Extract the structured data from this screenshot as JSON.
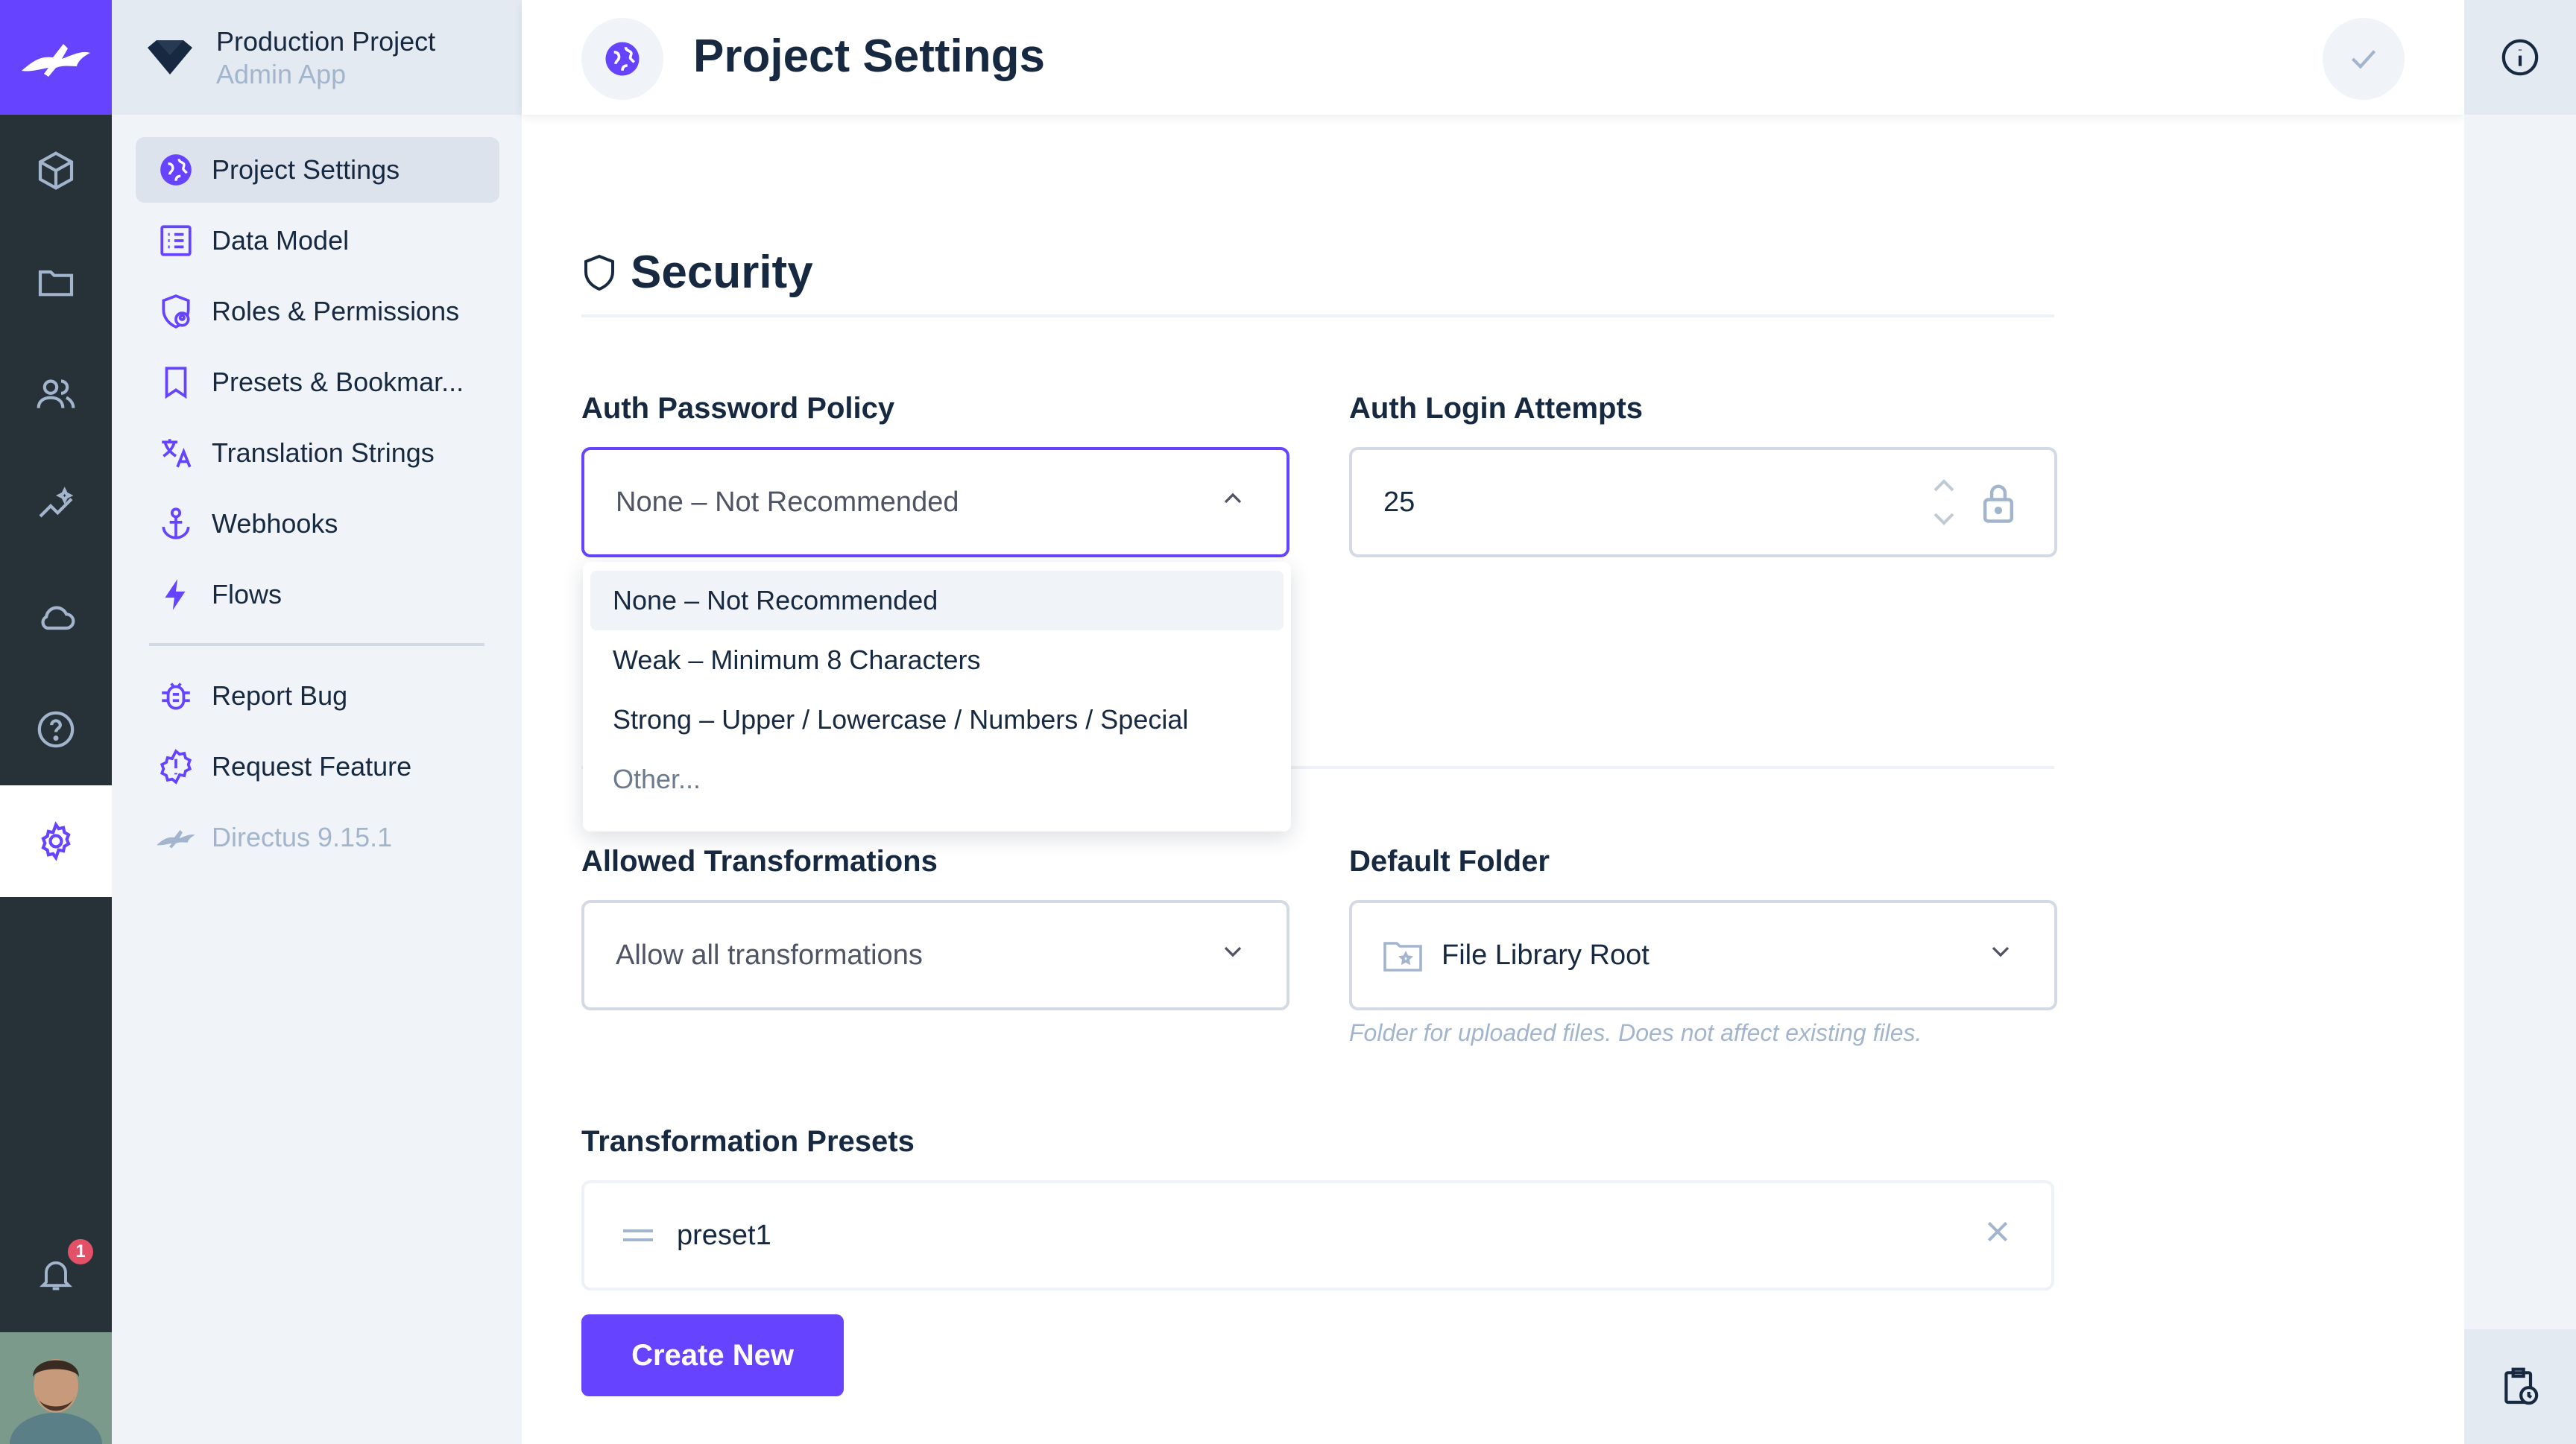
{
  "project": {
    "name": "Production Project",
    "subtitle": "Admin App"
  },
  "header": {
    "title": "Project Settings"
  },
  "nav": {
    "items": [
      {
        "label": "Project Settings",
        "icon": "globe-icon",
        "active": true
      },
      {
        "label": "Data Model",
        "icon": "list-alt-icon"
      },
      {
        "label": "Roles & Permissions",
        "icon": "shield-user-icon"
      },
      {
        "label": "Presets & Bookmar...",
        "icon": "bookmark-icon"
      },
      {
        "label": "Translation Strings",
        "icon": "translate-icon"
      },
      {
        "label": "Webhooks",
        "icon": "anchor-icon"
      },
      {
        "label": "Flows",
        "icon": "bolt-icon"
      }
    ],
    "footer": [
      {
        "label": "Report Bug",
        "icon": "bug-icon"
      },
      {
        "label": "Request Feature",
        "icon": "new-releases-icon"
      },
      {
        "label": "Directus 9.15.1",
        "icon": "directus-rabbit-icon"
      }
    ]
  },
  "modules": [
    "content-icon",
    "files-icon",
    "users-icon",
    "insights-icon",
    "cloud-icon",
    "help-icon",
    "settings-icon"
  ],
  "notifications": {
    "count": "1"
  },
  "security": {
    "title": "Security",
    "password_policy": {
      "label": "Auth Password Policy",
      "value": "None – Not Recommended",
      "options": [
        "None – Not Recommended",
        "Weak – Minimum 8 Characters",
        "Strong – Upper / Lowercase / Numbers / Special",
        "Other..."
      ]
    },
    "login_attempts": {
      "label": "Auth Login Attempts",
      "value": "25"
    }
  },
  "files": {
    "allowed_transformations": {
      "label": "Allowed Transformations",
      "value": "Allow all transformations"
    },
    "default_folder": {
      "label": "Default Folder",
      "value": "File Library Root",
      "hint": "Folder for uploaded files. Does not affect existing files."
    },
    "presets": {
      "label": "Transformation Presets",
      "items": [
        "preset1"
      ],
      "create_label": "Create New"
    }
  },
  "colors": {
    "accent": "#6644ff",
    "module_bar": "#263238",
    "nav_bg": "#f0f4f9",
    "badge": "#e35169"
  }
}
